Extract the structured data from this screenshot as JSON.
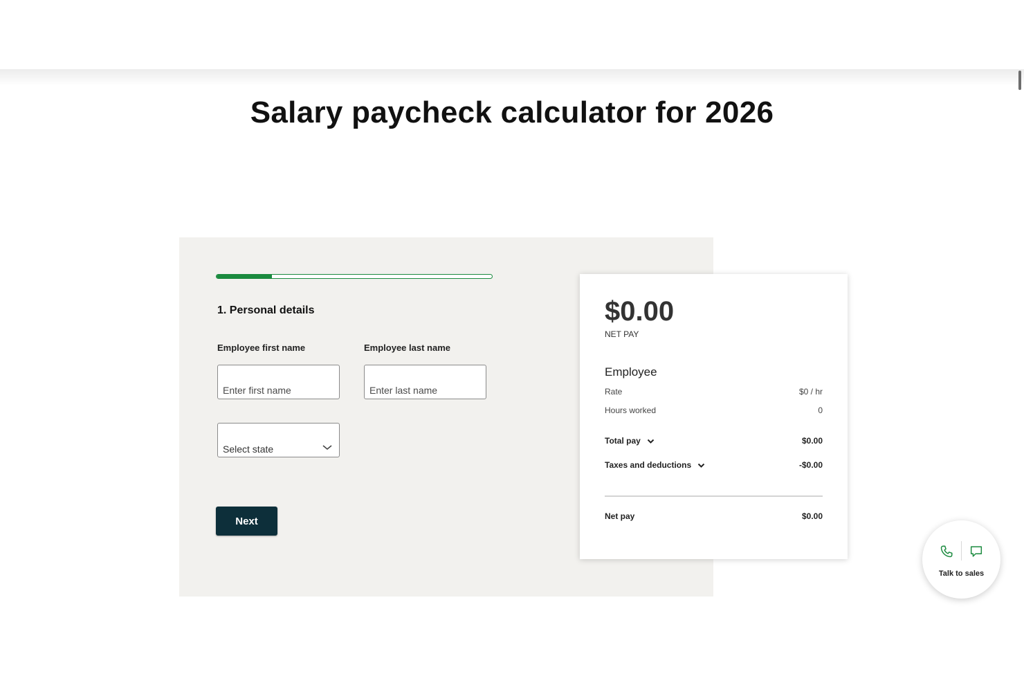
{
  "header": {
    "title": "Salary paycheck calculator for 2026"
  },
  "form": {
    "progress_fraction": 0.2,
    "step_title": "1. Personal details",
    "first_name": {
      "label": "Employee first name",
      "placeholder": "Enter first name",
      "value": ""
    },
    "last_name": {
      "label": "Employee last name",
      "placeholder": "Enter last name",
      "value": ""
    },
    "state": {
      "selected": "Select state"
    },
    "next_label": "Next"
  },
  "summary": {
    "net_amount": "$0.00",
    "net_label": "NET PAY",
    "employee_heading": "Employee",
    "rate": {
      "label": "Rate",
      "value": "$0 / hr"
    },
    "hours": {
      "label": "Hours worked",
      "value": "0"
    },
    "total_pay": {
      "label": "Total pay",
      "value": "$0.00"
    },
    "taxes": {
      "label": "Taxes and deductions",
      "value": "-$0.00"
    },
    "net_pay": {
      "label": "Net pay",
      "value": "$0.00"
    }
  },
  "sales_widget": {
    "label": "Talk to sales",
    "icons": [
      "phone-icon",
      "chat-icon"
    ]
  },
  "colors": {
    "accent_green": "#1a8a3e",
    "button_dark": "#0d2f3a",
    "card_bg": "#f2f1ee"
  }
}
